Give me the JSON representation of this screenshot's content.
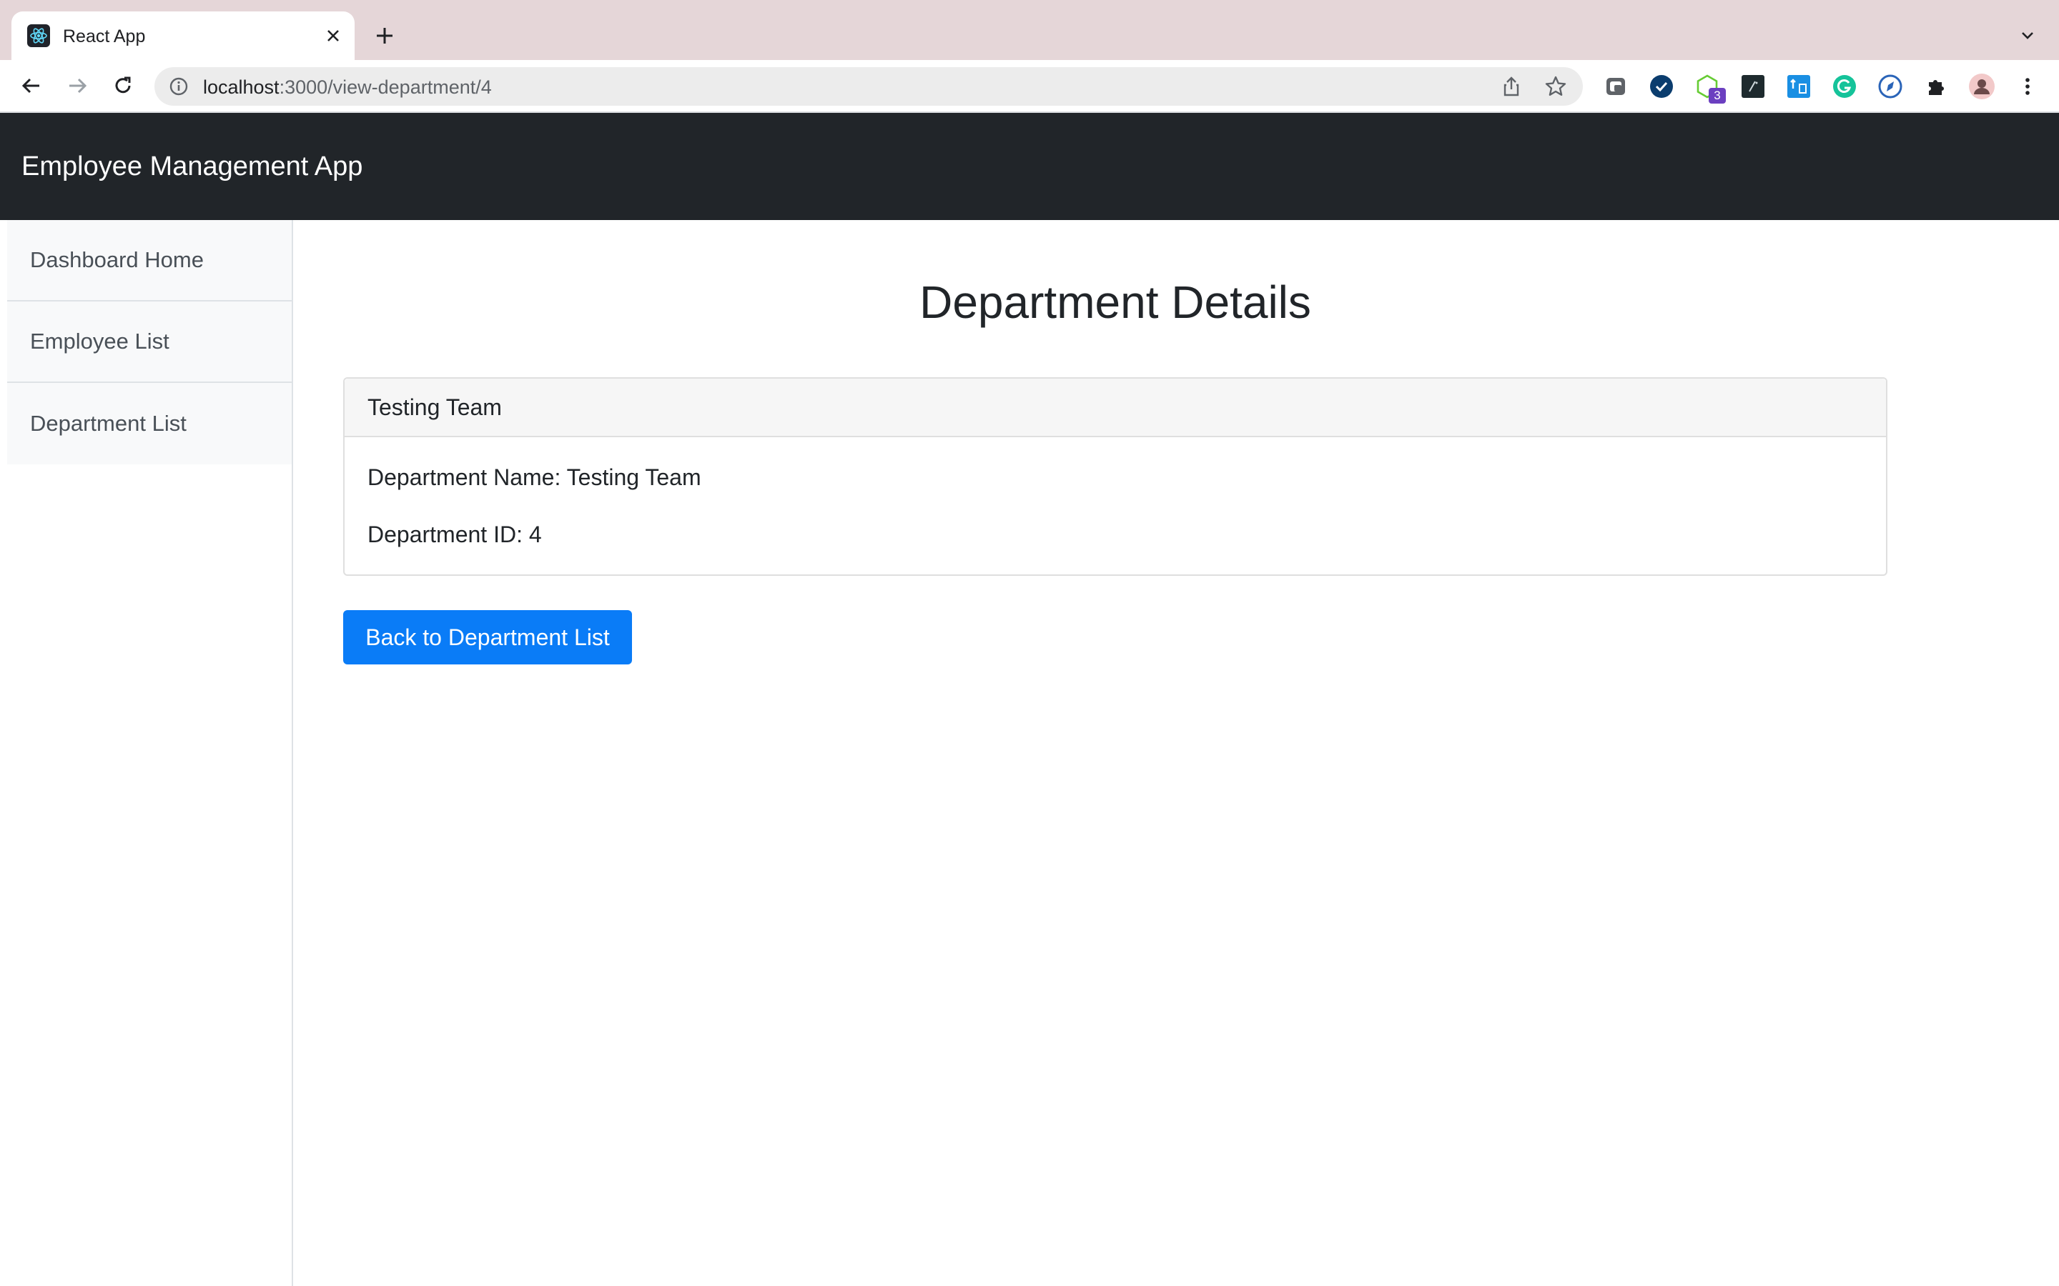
{
  "browser": {
    "tab_title": "React App",
    "url_host": "localhost",
    "url_path": ":3000/view-department/4",
    "extension_badge": "3"
  },
  "app": {
    "brand": "Employee Management App"
  },
  "sidebar": {
    "items": [
      {
        "label": "Dashboard Home"
      },
      {
        "label": "Employee List"
      },
      {
        "label": "Department List"
      }
    ]
  },
  "main": {
    "title": "Department Details",
    "card": {
      "header": "Testing Team",
      "name_line": "Department Name: Testing Team",
      "id_line": "Department ID: 4"
    },
    "back_button": "Back to Department List"
  },
  "colors": {
    "navbar": "#212529",
    "primary_button": "#0a7cf7",
    "tabstrip": "#e5d6d8"
  }
}
